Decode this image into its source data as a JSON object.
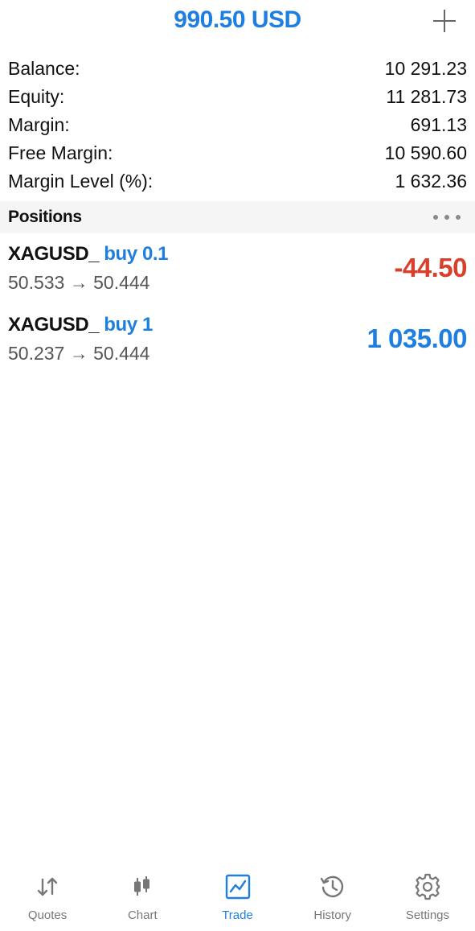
{
  "header": {
    "title": "990.50 USD",
    "add_icon": "plus-icon"
  },
  "summary": {
    "rows": [
      {
        "label": "Balance:",
        "value": "10 291.23"
      },
      {
        "label": "Equity:",
        "value": "11 281.73"
      },
      {
        "label": "Margin:",
        "value": "691.13"
      },
      {
        "label": "Free Margin:",
        "value": "10 590.60"
      },
      {
        "label": "Margin Level (%):",
        "value": "1 632.36"
      }
    ]
  },
  "positions": {
    "title": "Positions",
    "more_icon": "more-horizontal-icon",
    "items": [
      {
        "symbol": "XAGUSD_",
        "side": "buy 0.1",
        "prices": "50.533 → 50.444",
        "profit": "-44.50",
        "profit_color": "#d9402b"
      },
      {
        "symbol": "XAGUSD_",
        "side": "buy 1",
        "prices": "50.237 → 50.444",
        "profit": "1 035.00",
        "profit_color": "#1f7fe0"
      }
    ]
  },
  "tabbar": {
    "active": "Trade",
    "items": [
      {
        "label": "Quotes",
        "icon": "quotes-arrows-icon"
      },
      {
        "label": "Chart",
        "icon": "candlestick-chart-icon"
      },
      {
        "label": "Trade",
        "icon": "trade-trend-icon"
      },
      {
        "label": "History",
        "icon": "history-clock-icon"
      },
      {
        "label": "Settings",
        "icon": "gear-icon"
      }
    ]
  },
  "colors": {
    "accent": "#1f7fe0",
    "loss": "#d9402b",
    "inactive": "#777777"
  }
}
